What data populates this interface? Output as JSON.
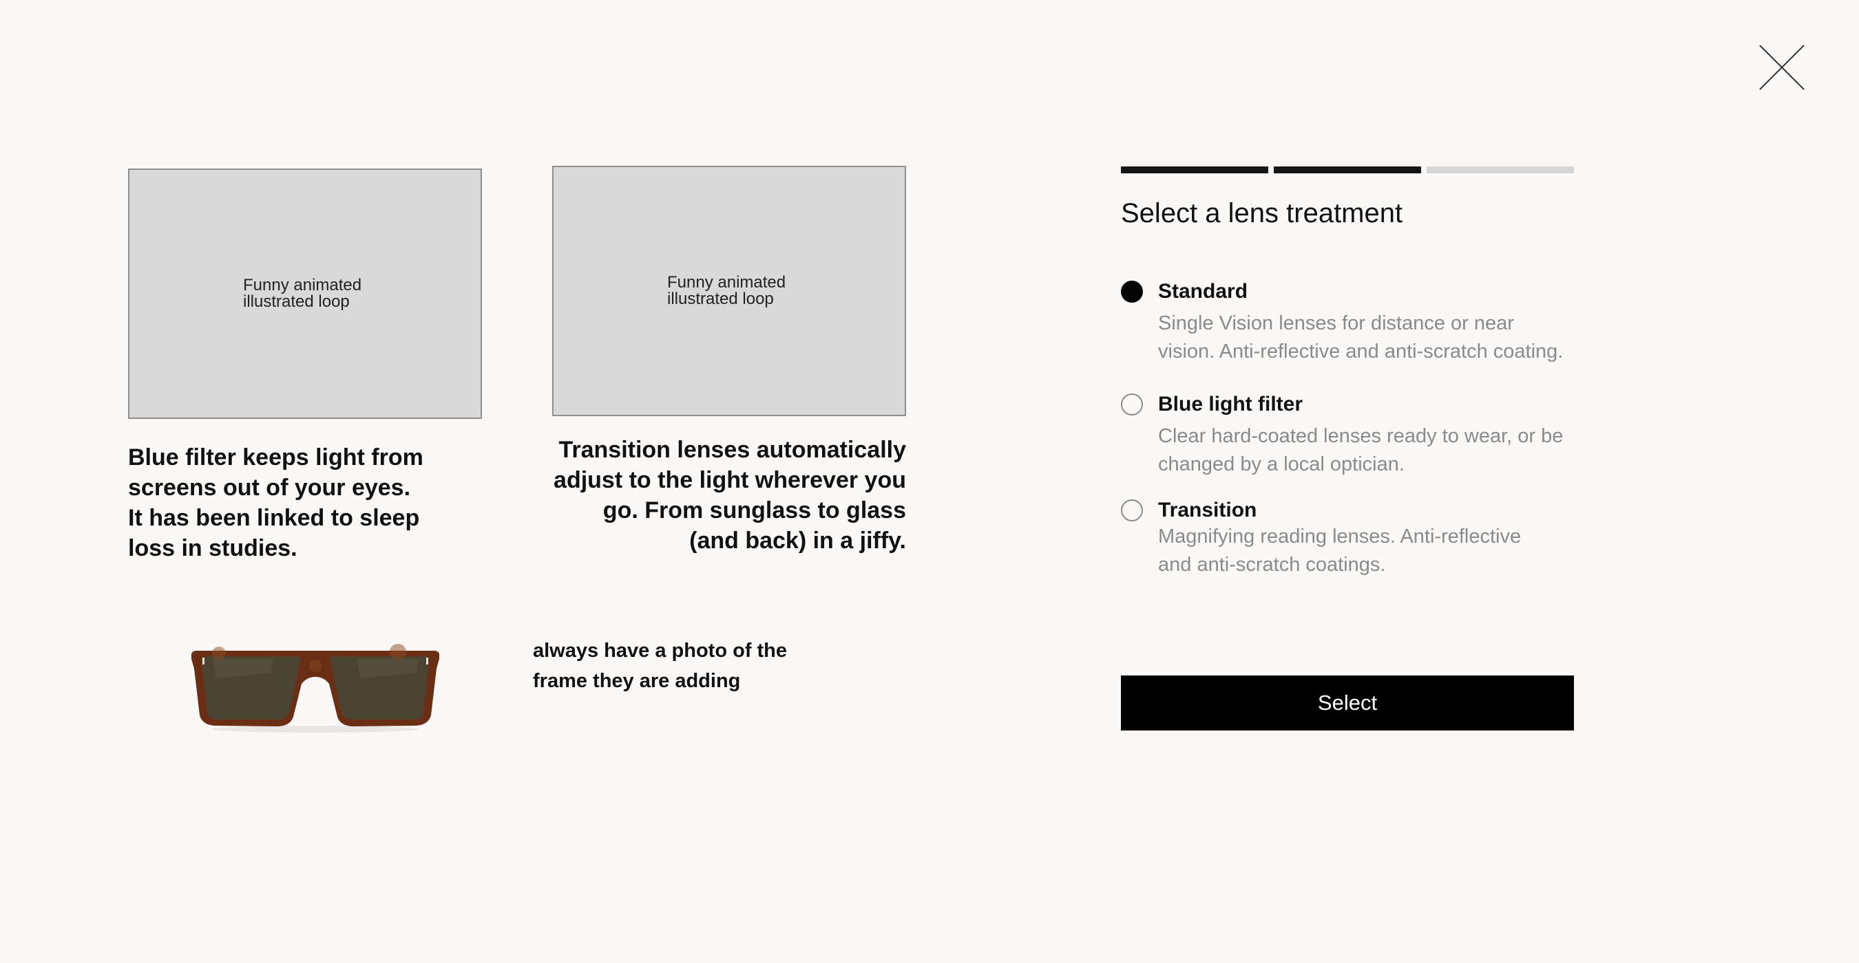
{
  "close": {
    "icon": "close-icon"
  },
  "media": [
    {
      "placeholder_text": "Funny animated illustrated loop",
      "caption": "Blue filter keeps light from screens out of your eyes. It has been linked to sleep loss in studies."
    },
    {
      "placeholder_text": "Funny animated illustrated loop",
      "caption": "Transition lenses automatically adjust to the light wherever you go. From sunglass to glass (and back) in a jiffy."
    }
  ],
  "frame": {
    "note": "always have a photo of the frame they are adding"
  },
  "progress": {
    "total_steps": 3,
    "completed_steps": 2
  },
  "panel": {
    "title": "Select a lens treatment",
    "selected": "Standard",
    "options": [
      {
        "label": "Standard",
        "description": "Single Vision lenses for distance or near vision. Anti-reflective and anti-scratch coating.",
        "checked": true
      },
      {
        "label": "Blue light filter",
        "description": "Clear hard-coated lenses ready to wear, or be changed by a local optician.",
        "checked": false
      },
      {
        "label": "Transition",
        "description": "Magnifying reading lenses. Anti-reflective and anti-scratch coatings.",
        "checked": false
      }
    ],
    "submit_label": "Select"
  },
  "colors": {
    "background": "#faf9f7",
    "accent": "#000000",
    "placeholder": "#d9d9d9",
    "muted_text": "#8a8a8a",
    "progress_done": "#151515",
    "progress_todo": "#d6d6d6"
  }
}
